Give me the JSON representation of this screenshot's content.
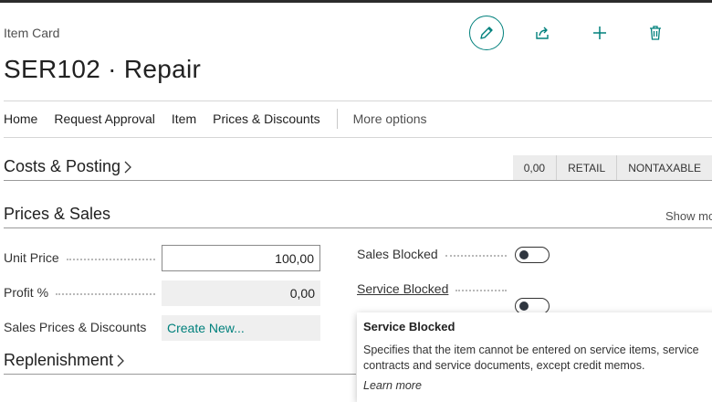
{
  "header": {
    "breadcrumb": "Item Card",
    "title": "SER102 · Repair",
    "actions": [
      "edit-icon",
      "share-icon",
      "add-icon",
      "delete-icon"
    ]
  },
  "nav": {
    "items": [
      "Home",
      "Request Approval",
      "Item",
      "Prices & Discounts"
    ],
    "more": "More options"
  },
  "costs": {
    "title": "Costs & Posting",
    "badges": [
      "0,00",
      "RETAIL",
      "NONTAXABLE"
    ]
  },
  "prices": {
    "title": "Prices & Sales",
    "show_more": "Show more",
    "unit_price_label": "Unit Price",
    "unit_price_value": "100,00",
    "profit_label": "Profit %",
    "profit_value": "0,00",
    "sales_prices_label": "Sales Prices & Discounts",
    "sales_prices_link": "Create New...",
    "sales_blocked_label": "Sales Blocked",
    "sales_blocked": false,
    "service_blocked_label": "Service Blocked",
    "service_blocked": false
  },
  "replenishment": {
    "title": "Replenishment"
  },
  "tooltip": {
    "title": "Service Blocked",
    "body": "Specifies that the item cannot be entered on service items, service contracts and service documents, except credit memos.",
    "link": "Learn more"
  },
  "colors": {
    "accent": "#00807c",
    "field_bg": "#efefef"
  }
}
